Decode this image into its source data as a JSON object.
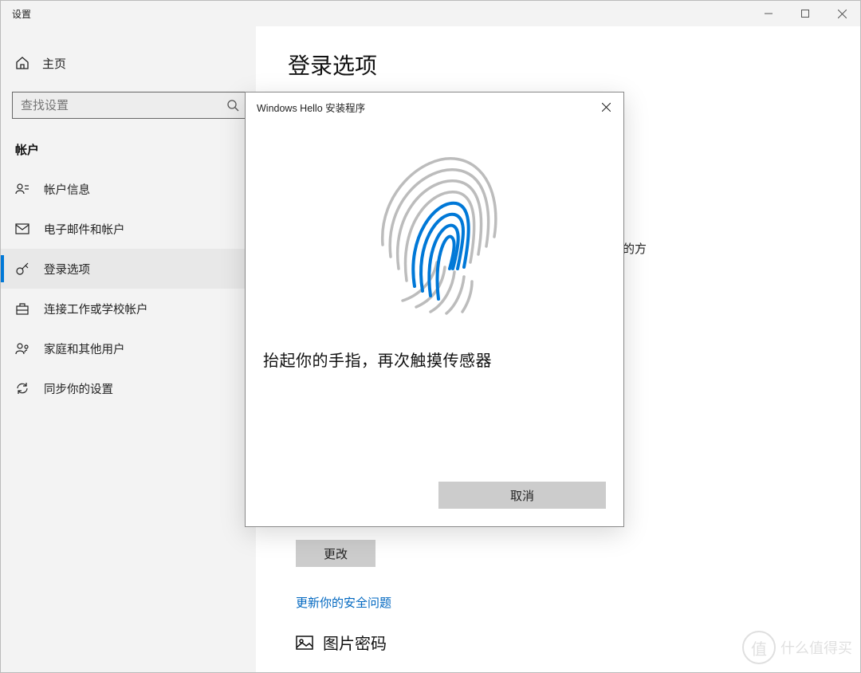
{
  "window": {
    "title": "设置"
  },
  "sidebar": {
    "home": "主页",
    "search_placeholder": "查找设置",
    "section": "帐户",
    "items": [
      {
        "label": "帐户信息"
      },
      {
        "label": "电子邮件和帐户"
      },
      {
        "label": "登录选项"
      },
      {
        "label": "连接工作或学校帐户"
      },
      {
        "label": "家庭和其他用户"
      },
      {
        "label": "同步你的设置"
      }
    ]
  },
  "content": {
    "title": "登录选项",
    "peek": "的方",
    "cut_label": "",
    "change_btn": "更改",
    "security_link": "更新你的安全问题",
    "picture_pwd": "图片密码"
  },
  "dialog": {
    "title": "Windows Hello 安装程序",
    "message": "抬起你的手指，再次触摸传感器",
    "cancel": "取消"
  },
  "watermark": {
    "badge": "值",
    "text": "什么值得买"
  }
}
